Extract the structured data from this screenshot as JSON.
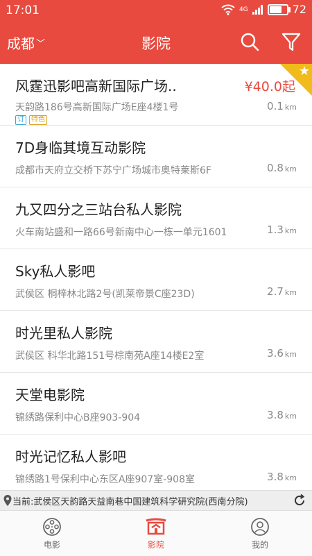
{
  "status": {
    "time": "17:01",
    "network": "4G",
    "battery": "72",
    "battery_level": 0.72
  },
  "header": {
    "city": "成都",
    "title": "影院",
    "search_icon": "search-icon",
    "filter_icon": "filter-icon"
  },
  "colors": {
    "brand": "#e84a3f",
    "gold": "#f2bb1c",
    "tag_blue": "#3aa7d8",
    "tag_gold": "#e0a21a"
  },
  "cinemas": [
    {
      "name": "风霆迅影吧高新国际广场..",
      "address": "天韵路186号高新国际广场E座4楼1号",
      "distance": "0.1",
      "unit": "km",
      "price": "¥40.0起",
      "tags": [
        "订",
        "特色"
      ],
      "featured": true
    },
    {
      "name": "7D身临其境互动影院",
      "address": "成都市天府立交桥下苏宁广场城市奥特莱斯6F",
      "distance": "0.8",
      "unit": "km"
    },
    {
      "name": "九又四分之三站台私人影院",
      "address": "火车南站盛和一路66号新南中心一栋一单元1601",
      "distance": "1.3",
      "unit": "km"
    },
    {
      "name": "Sky私人影吧",
      "address": "武侯区 桐梓林北路2号(凯莱帝景C座23D)",
      "distance": "2.7",
      "unit": "km"
    },
    {
      "name": "时光里私人影院",
      "address": "武侯区 科华北路151号棕南苑A座14楼E2室",
      "distance": "3.6",
      "unit": "km"
    },
    {
      "name": "天堂电影院",
      "address": "锦绣路保利中心B座903-904",
      "distance": "3.8",
      "unit": "km"
    },
    {
      "name": "时光记忆私人影吧",
      "address": "锦绣路1号保利中心东区A座907室-908室",
      "distance": "3.8",
      "unit": "km"
    }
  ],
  "location": {
    "text": "当前:武侯区天韵路天益南巷中国建筑科学研究院(西南分院)"
  },
  "tabs": [
    {
      "label": "电影",
      "icon": "film-reel-icon",
      "active": false
    },
    {
      "label": "影院",
      "icon": "cinema-icon",
      "active": true
    },
    {
      "label": "我的",
      "icon": "profile-icon",
      "active": false
    }
  ]
}
